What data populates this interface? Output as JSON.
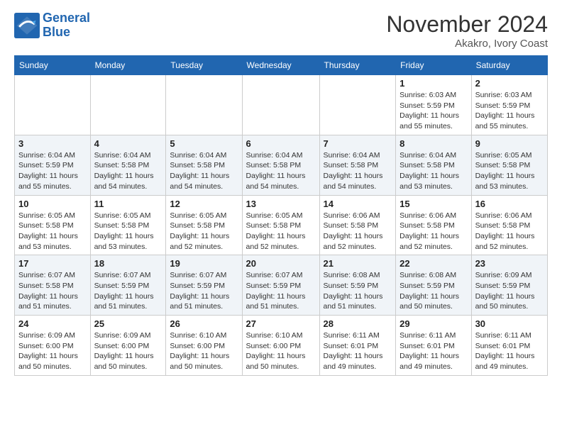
{
  "header": {
    "logo_line1": "General",
    "logo_line2": "Blue",
    "month": "November 2024",
    "location": "Akakro, Ivory Coast"
  },
  "weekdays": [
    "Sunday",
    "Monday",
    "Tuesday",
    "Wednesday",
    "Thursday",
    "Friday",
    "Saturday"
  ],
  "weeks": [
    [
      {
        "day": "",
        "info": ""
      },
      {
        "day": "",
        "info": ""
      },
      {
        "day": "",
        "info": ""
      },
      {
        "day": "",
        "info": ""
      },
      {
        "day": "",
        "info": ""
      },
      {
        "day": "1",
        "info": "Sunrise: 6:03 AM\nSunset: 5:59 PM\nDaylight: 11 hours and 55 minutes."
      },
      {
        "day": "2",
        "info": "Sunrise: 6:03 AM\nSunset: 5:59 PM\nDaylight: 11 hours and 55 minutes."
      }
    ],
    [
      {
        "day": "3",
        "info": "Sunrise: 6:04 AM\nSunset: 5:59 PM\nDaylight: 11 hours and 55 minutes."
      },
      {
        "day": "4",
        "info": "Sunrise: 6:04 AM\nSunset: 5:58 PM\nDaylight: 11 hours and 54 minutes."
      },
      {
        "day": "5",
        "info": "Sunrise: 6:04 AM\nSunset: 5:58 PM\nDaylight: 11 hours and 54 minutes."
      },
      {
        "day": "6",
        "info": "Sunrise: 6:04 AM\nSunset: 5:58 PM\nDaylight: 11 hours and 54 minutes."
      },
      {
        "day": "7",
        "info": "Sunrise: 6:04 AM\nSunset: 5:58 PM\nDaylight: 11 hours and 54 minutes."
      },
      {
        "day": "8",
        "info": "Sunrise: 6:04 AM\nSunset: 5:58 PM\nDaylight: 11 hours and 53 minutes."
      },
      {
        "day": "9",
        "info": "Sunrise: 6:05 AM\nSunset: 5:58 PM\nDaylight: 11 hours and 53 minutes."
      }
    ],
    [
      {
        "day": "10",
        "info": "Sunrise: 6:05 AM\nSunset: 5:58 PM\nDaylight: 11 hours and 53 minutes."
      },
      {
        "day": "11",
        "info": "Sunrise: 6:05 AM\nSunset: 5:58 PM\nDaylight: 11 hours and 53 minutes."
      },
      {
        "day": "12",
        "info": "Sunrise: 6:05 AM\nSunset: 5:58 PM\nDaylight: 11 hours and 52 minutes."
      },
      {
        "day": "13",
        "info": "Sunrise: 6:05 AM\nSunset: 5:58 PM\nDaylight: 11 hours and 52 minutes."
      },
      {
        "day": "14",
        "info": "Sunrise: 6:06 AM\nSunset: 5:58 PM\nDaylight: 11 hours and 52 minutes."
      },
      {
        "day": "15",
        "info": "Sunrise: 6:06 AM\nSunset: 5:58 PM\nDaylight: 11 hours and 52 minutes."
      },
      {
        "day": "16",
        "info": "Sunrise: 6:06 AM\nSunset: 5:58 PM\nDaylight: 11 hours and 52 minutes."
      }
    ],
    [
      {
        "day": "17",
        "info": "Sunrise: 6:07 AM\nSunset: 5:58 PM\nDaylight: 11 hours and 51 minutes."
      },
      {
        "day": "18",
        "info": "Sunrise: 6:07 AM\nSunset: 5:59 PM\nDaylight: 11 hours and 51 minutes."
      },
      {
        "day": "19",
        "info": "Sunrise: 6:07 AM\nSunset: 5:59 PM\nDaylight: 11 hours and 51 minutes."
      },
      {
        "day": "20",
        "info": "Sunrise: 6:07 AM\nSunset: 5:59 PM\nDaylight: 11 hours and 51 minutes."
      },
      {
        "day": "21",
        "info": "Sunrise: 6:08 AM\nSunset: 5:59 PM\nDaylight: 11 hours and 51 minutes."
      },
      {
        "day": "22",
        "info": "Sunrise: 6:08 AM\nSunset: 5:59 PM\nDaylight: 11 hours and 50 minutes."
      },
      {
        "day": "23",
        "info": "Sunrise: 6:09 AM\nSunset: 5:59 PM\nDaylight: 11 hours and 50 minutes."
      }
    ],
    [
      {
        "day": "24",
        "info": "Sunrise: 6:09 AM\nSunset: 6:00 PM\nDaylight: 11 hours and 50 minutes."
      },
      {
        "day": "25",
        "info": "Sunrise: 6:09 AM\nSunset: 6:00 PM\nDaylight: 11 hours and 50 minutes."
      },
      {
        "day": "26",
        "info": "Sunrise: 6:10 AM\nSunset: 6:00 PM\nDaylight: 11 hours and 50 minutes."
      },
      {
        "day": "27",
        "info": "Sunrise: 6:10 AM\nSunset: 6:00 PM\nDaylight: 11 hours and 50 minutes."
      },
      {
        "day": "28",
        "info": "Sunrise: 6:11 AM\nSunset: 6:01 PM\nDaylight: 11 hours and 49 minutes."
      },
      {
        "day": "29",
        "info": "Sunrise: 6:11 AM\nSunset: 6:01 PM\nDaylight: 11 hours and 49 minutes."
      },
      {
        "day": "30",
        "info": "Sunrise: 6:11 AM\nSunset: 6:01 PM\nDaylight: 11 hours and 49 minutes."
      }
    ]
  ]
}
